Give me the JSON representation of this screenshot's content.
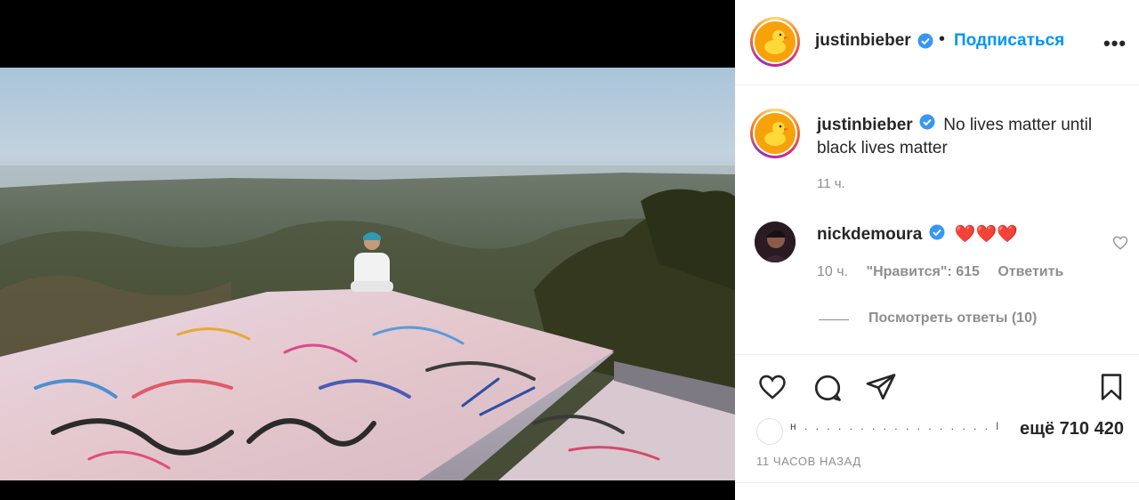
{
  "header": {
    "username": "justinbieber",
    "separator": "•",
    "follow_label": "Подписаться",
    "more_label": "•••"
  },
  "caption": {
    "username": "justinbieber",
    "text": "No lives matter until black lives matter",
    "time": "11 ч."
  },
  "comment": {
    "username": "nickdemoura",
    "text": "❤️❤️❤️",
    "time": "10 ч.",
    "likes": "\"Нравится\": 615",
    "reply_label": "Ответить",
    "view_replies_label": "Посмотреть ответы (10)"
  },
  "likes": {
    "blurred_names": "н . . . . . . . . . . . . . . . . . l",
    "more_label": "ещё 710 420"
  },
  "post_time": "11 ЧАСОВ НАЗАД",
  "colors": {
    "link_blue": "#0095f6",
    "verified_blue": "#3897f0",
    "muted_gray": "#8e8e8e",
    "heart_red": "#e0245e",
    "avatar_yellow": "#f7a20b"
  },
  "icons": {
    "verified": "verified-badge-icon",
    "like": "heart-outline-icon",
    "comment": "speech-bubble-icon",
    "share": "paper-plane-icon",
    "save": "bookmark-icon",
    "comment_like": "small-heart-icon",
    "avatar": "rubber-duck-icon"
  }
}
